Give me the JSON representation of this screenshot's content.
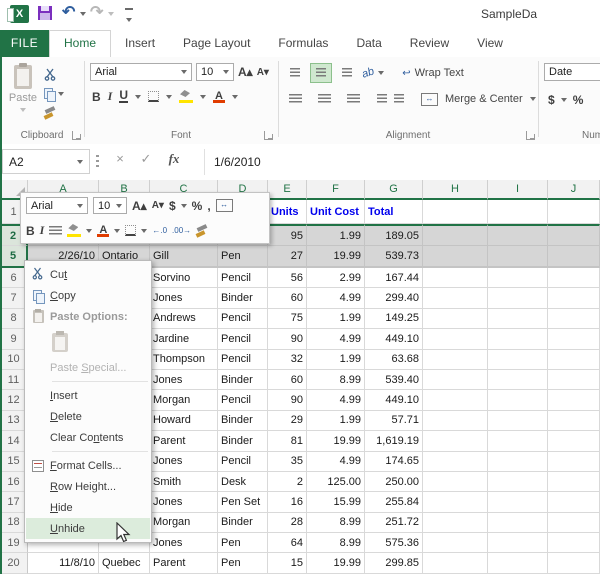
{
  "window": {
    "title": "SampleDa"
  },
  "tabs": {
    "file": "FILE",
    "items": [
      "Home",
      "Insert",
      "Page Layout",
      "Formulas",
      "Data",
      "Review",
      "View"
    ],
    "active": "Home"
  },
  "ribbon": {
    "clipboard": {
      "group_label": "Clipboard",
      "paste_label": "Paste"
    },
    "font": {
      "group_label": "Font",
      "name": "Arial",
      "size": "10",
      "bold": "B",
      "italic": "I",
      "underline": "U"
    },
    "alignment": {
      "group_label": "Alignment",
      "wrap_text_label": "Wrap Text",
      "merge_center_label": "Merge & Center"
    },
    "number": {
      "group_label": "Num",
      "format_value": "Date",
      "currency": "$",
      "percent": "%"
    }
  },
  "formula_bar": {
    "name_box": "A2",
    "cancel": "×",
    "enter": "✓",
    "fx": "fx",
    "value": "1/6/2010"
  },
  "mini_toolbar": {
    "font_name": "Arial",
    "font_size": "10",
    "bold": "B",
    "italic": "I",
    "currency": "$",
    "percent": "%",
    "comma": ",",
    "dec_left": "←.0",
    "dec_right": ".00→"
  },
  "grid": {
    "columns": [
      "A",
      "B",
      "C",
      "D",
      "E",
      "F",
      "G",
      "H",
      "I",
      "J"
    ],
    "rows": [
      {
        "n": "1",
        "style": "header",
        "cells": {
          "E": "Units",
          "F": "Unit Cost",
          "G": "Total"
        }
      },
      {
        "n": "2",
        "selected": true,
        "cells": {
          "E": "95",
          "F": "1.99",
          "G": "189.05"
        }
      },
      {
        "n": "5",
        "selected": true,
        "cells": {
          "A": "2/26/10",
          "B": "Ontario",
          "C": "Gill",
          "D": "Pen",
          "E": "27",
          "F": "19.99",
          "G": "539.73"
        }
      },
      {
        "n": "6",
        "cells": {
          "C": "Sorvino",
          "D": "Pencil",
          "E": "56",
          "F": "2.99",
          "G": "167.44"
        }
      },
      {
        "n": "7",
        "cells": {
          "C": "Jones",
          "D": "Binder",
          "E": "60",
          "F": "4.99",
          "G": "299.40"
        }
      },
      {
        "n": "8",
        "cells": {
          "C": "Andrews",
          "D": "Pencil",
          "E": "75",
          "F": "1.99",
          "G": "149.25"
        }
      },
      {
        "n": "9",
        "cells": {
          "C": "Jardine",
          "D": "Pencil",
          "E": "90",
          "F": "4.99",
          "G": "449.10"
        }
      },
      {
        "n": "10",
        "cells": {
          "C": "Thompson",
          "D": "Pencil",
          "E": "32",
          "F": "1.99",
          "G": "63.68"
        }
      },
      {
        "n": "11",
        "cells": {
          "C": "Jones",
          "D": "Binder",
          "E": "60",
          "F": "8.99",
          "G": "539.40"
        }
      },
      {
        "n": "12",
        "cells": {
          "C": "Morgan",
          "D": "Pencil",
          "E": "90",
          "F": "4.99",
          "G": "449.10"
        }
      },
      {
        "n": "13",
        "cells": {
          "C": "Howard",
          "D": "Binder",
          "E": "29",
          "F": "1.99",
          "G": "57.71"
        }
      },
      {
        "n": "14",
        "cells": {
          "C": "Parent",
          "D": "Binder",
          "E": "81",
          "F": "19.99",
          "G": "1,619.19"
        }
      },
      {
        "n": "15",
        "cells": {
          "C": "Jones",
          "D": "Pencil",
          "E": "35",
          "F": "4.99",
          "G": "174.65"
        }
      },
      {
        "n": "16",
        "cells": {
          "C": "Smith",
          "D": "Desk",
          "E": "2",
          "F": "125.00",
          "G": "250.00"
        }
      },
      {
        "n": "17",
        "cells": {
          "C": "Jones",
          "D": "Pen Set",
          "E": "16",
          "F": "15.99",
          "G": "255.84"
        }
      },
      {
        "n": "18",
        "cells": {
          "C": "Morgan",
          "D": "Binder",
          "E": "28",
          "F": "8.99",
          "G": "251.72"
        }
      },
      {
        "n": "19",
        "cells": {
          "C": "Jones",
          "D": "Pen",
          "E": "64",
          "F": "8.99",
          "G": "575.36"
        }
      },
      {
        "n": "20",
        "cells": {
          "A": "11/8/10",
          "B": "Quebec",
          "C": "Parent",
          "D": "Pen",
          "E": "15",
          "F": "19.99",
          "G": "299.85"
        }
      }
    ]
  },
  "context_menu": {
    "items": [
      {
        "name": "cut",
        "pre": "Cu",
        "key": "t",
        "post": "",
        "icon": "scissors-icon"
      },
      {
        "name": "copy",
        "pre": "",
        "key": "C",
        "post": "opy",
        "icon": "copy-icon"
      },
      {
        "name": "paste-options",
        "type": "label",
        "pre": "Paste Options:",
        "key": "",
        "post": "",
        "icon": "paste-icon"
      },
      {
        "name": "paste-button",
        "type": "paste-icon-row"
      },
      {
        "name": "paste-special",
        "pre": "Paste ",
        "key": "S",
        "post": "pecial...",
        "disabled": true
      },
      {
        "type": "separator"
      },
      {
        "name": "insert",
        "pre": "",
        "key": "I",
        "post": "nsert"
      },
      {
        "name": "delete",
        "pre": "",
        "key": "D",
        "post": "elete"
      },
      {
        "name": "clear-contents",
        "pre": "Clear Co",
        "key": "n",
        "post": "tents"
      },
      {
        "type": "separator"
      },
      {
        "name": "format-cells",
        "pre": "",
        "key": "F",
        "post": "ormat Cells...",
        "icon": "format-cells-icon"
      },
      {
        "name": "row-height",
        "pre": "",
        "key": "R",
        "post": "ow Height..."
      },
      {
        "name": "hide",
        "pre": "",
        "key": "H",
        "post": "ide"
      },
      {
        "name": "unhide",
        "pre": "",
        "key": "U",
        "post": "nhide",
        "highlighted": true
      }
    ]
  },
  "colors": {
    "accent_green": "#217346",
    "selection_fill": "#d6d6d6",
    "header_text_blue": "#0000ee",
    "menu_highlight": "#dcecdc"
  }
}
